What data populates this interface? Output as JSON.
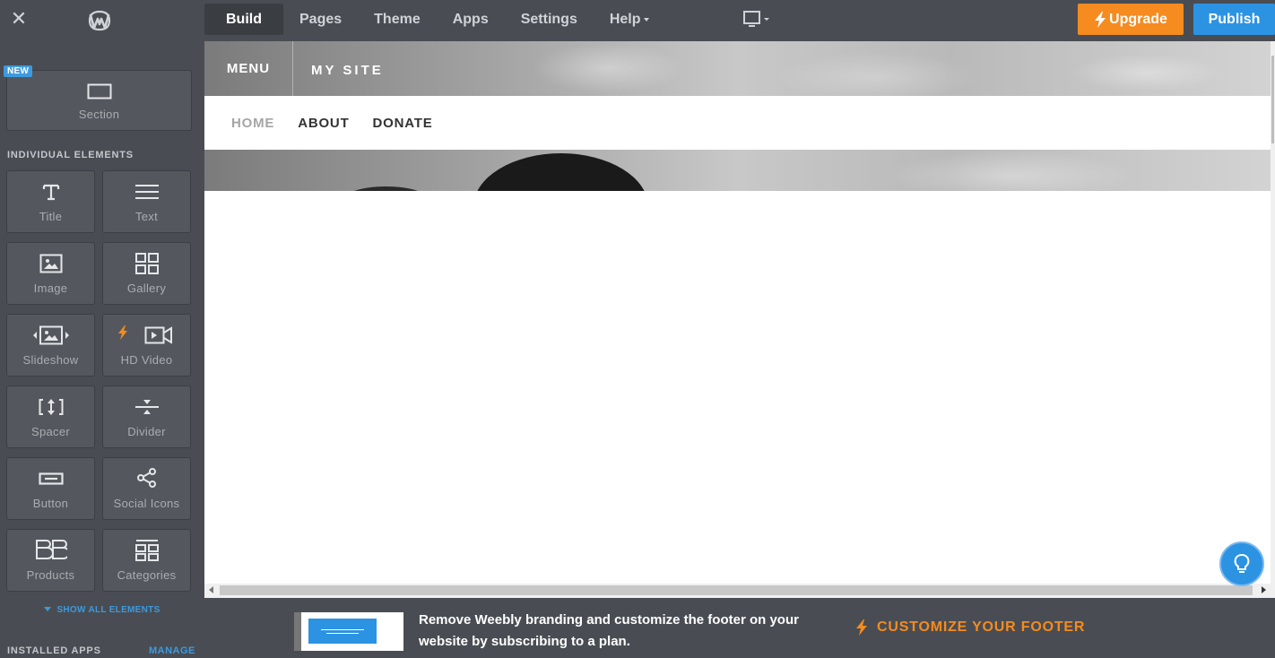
{
  "topbar": {
    "tabs": [
      {
        "label": "Build",
        "active": true
      },
      {
        "label": "Pages"
      },
      {
        "label": "Theme"
      },
      {
        "label": "Apps"
      },
      {
        "label": "Settings"
      },
      {
        "label": "Help"
      }
    ],
    "upgrade_label": "Upgrade",
    "publish_label": "Publish"
  },
  "sidebar": {
    "new_badge": "NEW",
    "section_tile": "Section",
    "individual_heading": "INDIVIDUAL ELEMENTS",
    "elements": [
      {
        "label": "Title",
        "icon": "title-icon"
      },
      {
        "label": "Text",
        "icon": "text-icon"
      },
      {
        "label": "Image",
        "icon": "image-icon"
      },
      {
        "label": "Gallery",
        "icon": "gallery-icon"
      },
      {
        "label": "Slideshow",
        "icon": "slideshow-icon"
      },
      {
        "label": "HD Video",
        "icon": "hd-video-icon"
      },
      {
        "label": "Spacer",
        "icon": "spacer-icon"
      },
      {
        "label": "Divider",
        "icon": "divider-icon"
      },
      {
        "label": "Button",
        "icon": "button-icon"
      },
      {
        "label": "Social Icons",
        "icon": "social-icons-icon"
      },
      {
        "label": "Products",
        "icon": "products-icon"
      },
      {
        "label": "Categories",
        "icon": "categories-icon"
      }
    ],
    "show_all": "SHOW ALL ELEMENTS",
    "installed_apps": "INSTALLED APPS",
    "manage": "MANAGE"
  },
  "site": {
    "menu": "MENU",
    "title": "MY SITE",
    "nav": [
      "HOME",
      "ABOUT",
      "DONATE"
    ]
  },
  "promo": {
    "text": "Remove Weebly branding and customize the footer on your website by subscribing to a plan.",
    "cta": "CUSTOMIZE YOUR FOOTER"
  },
  "colors": {
    "topbar_bg": "#494d53",
    "upgrade": "#f68b1f",
    "publish": "#2c93e3",
    "link_blue": "#3d9ade"
  }
}
